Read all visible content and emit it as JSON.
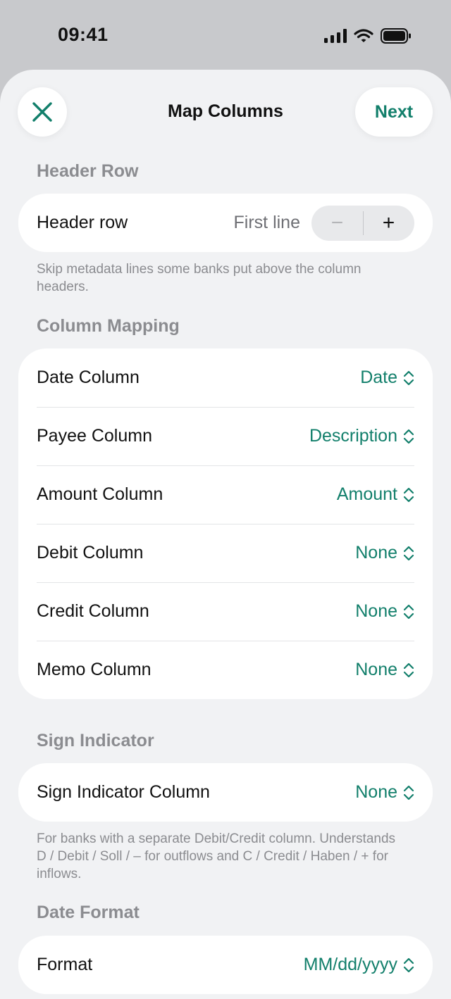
{
  "status_bar": {
    "time": "09:41"
  },
  "nav": {
    "title": "Map Columns",
    "next_label": "Next"
  },
  "header_row_section": {
    "title": "Header Row",
    "row_label": "Header row",
    "value": "First line",
    "decrement_symbol": "−",
    "increment_symbol": "+",
    "footer": "Skip metadata lines some banks put above the column headers."
  },
  "column_mapping": {
    "title": "Column Mapping",
    "rows": [
      {
        "label": "Date Column",
        "value": "Date"
      },
      {
        "label": "Payee Column",
        "value": "Description"
      },
      {
        "label": "Amount Column",
        "value": "Amount"
      },
      {
        "label": "Debit Column",
        "value": "None"
      },
      {
        "label": "Credit Column",
        "value": "None"
      },
      {
        "label": "Memo Column",
        "value": "None"
      }
    ]
  },
  "sign_indicator": {
    "title": "Sign Indicator",
    "row_label": "Sign Indicator Column",
    "value": "None",
    "footer": "For banks with a separate Debit/Credit column. Understands D / Debit / Soll / – for outflows and C / Credit / Haben / + for inflows."
  },
  "date_format": {
    "title": "Date Format",
    "row_label": "Format",
    "value": "MM/dd/yyyy"
  },
  "colors": {
    "accent": "#127f6b",
    "secondary_text": "#8b8c90",
    "background": "#f1f2f4"
  }
}
